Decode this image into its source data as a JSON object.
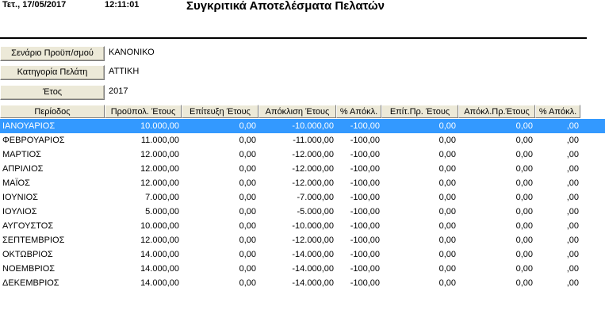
{
  "header": {
    "date": "Τετ., 17/05/2017",
    "time": "12:11:01",
    "title": "Συγκριτικά Αποτελέσματα Πελατών"
  },
  "params": {
    "scenario_label": "Σενάριο Προϋπ/σμού",
    "scenario_value": "ΚΑΝΟΝΙΚΟ",
    "category_label": "Κατηγορία Πελάτη",
    "category_value": "ΑΤΤΙΚΗ",
    "year_label": "Έτος",
    "year_value": "2017"
  },
  "columns": [
    "Περίοδος",
    "Προϋπολ. Έτους",
    "Επίτευξη Έτους",
    "Απόκλιση Έτους",
    "% Απόκλ.",
    "Επίτ.Πρ. Έτους",
    "Απόκλ.Πρ.Έτους",
    "% Απόκλ."
  ],
  "rows": [
    [
      "ΙΑΝΟΥΑΡΙΟΣ",
      "10.000,00",
      "0,00",
      "-10.000,00",
      "-100,00",
      "0,00",
      "0,00",
      ",00"
    ],
    [
      "ΦΕΒΡΟΥΑΡΙΟΣ",
      "11.000,00",
      "0,00",
      "-11.000,00",
      "-100,00",
      "0,00",
      "0,00",
      ",00"
    ],
    [
      "ΜΑΡΤΙΟΣ",
      "12.000,00",
      "0,00",
      "-12.000,00",
      "-100,00",
      "0,00",
      "0,00",
      ",00"
    ],
    [
      "ΑΠΡΙΛΙΟΣ",
      "12.000,00",
      "0,00",
      "-12.000,00",
      "-100,00",
      "0,00",
      "0,00",
      ",00"
    ],
    [
      "ΜΑΪΟΣ",
      "12.000,00",
      "0,00",
      "-12.000,00",
      "-100,00",
      "0,00",
      "0,00",
      ",00"
    ],
    [
      "ΙΟΥΝΙΟΣ",
      "7.000,00",
      "0,00",
      "-7.000,00",
      "-100,00",
      "0,00",
      "0,00",
      ",00"
    ],
    [
      "ΙΟΥΛΙΟΣ",
      "5.000,00",
      "0,00",
      "-5.000,00",
      "-100,00",
      "0,00",
      "0,00",
      ",00"
    ],
    [
      "ΑΥΓΟΥΣΤΟΣ",
      "10.000,00",
      "0,00",
      "-10.000,00",
      "-100,00",
      "0,00",
      "0,00",
      ",00"
    ],
    [
      "ΣΕΠΤΕΜΒΡΙΟΣ",
      "12.000,00",
      "0,00",
      "-12.000,00",
      "-100,00",
      "0,00",
      "0,00",
      ",00"
    ],
    [
      "ΟΚΤΩΒΡΙΟΣ",
      "14.000,00",
      "0,00",
      "-14.000,00",
      "-100,00",
      "0,00",
      "0,00",
      ",00"
    ],
    [
      "ΝΟΕΜΒΡΙΟΣ",
      "14.000,00",
      "0,00",
      "-14.000,00",
      "-100,00",
      "0,00",
      "0,00",
      ",00"
    ],
    [
      "ΔΕΚΕΜΒΡΙΟΣ",
      "14.000,00",
      "0,00",
      "-14.000,00",
      "-100,00",
      "0,00",
      "0,00",
      ",00"
    ]
  ],
  "selected_row": 0,
  "colors": {
    "selection": "#3399ff",
    "button_face": "#ece9d8"
  }
}
